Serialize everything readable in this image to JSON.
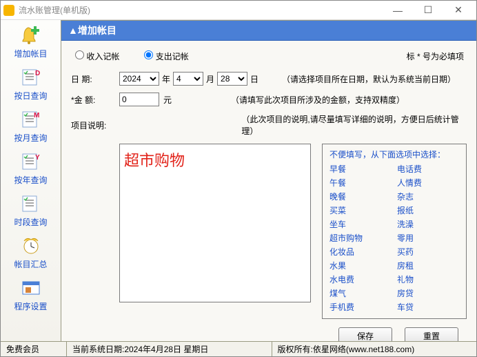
{
  "window": {
    "title": "流水账管理(单机版)"
  },
  "sidebar": {
    "items": [
      {
        "label": "增加帐目"
      },
      {
        "label": "按日查询"
      },
      {
        "label": "按月查询"
      },
      {
        "label": "按年查询"
      },
      {
        "label": "时段查询"
      },
      {
        "label": "帐目汇总"
      },
      {
        "label": "程序设置"
      }
    ]
  },
  "section": {
    "title": "▲增加帐目"
  },
  "radios": {
    "income": "收入记帐",
    "expense": "支出记帐"
  },
  "marker_note": "标 * 号为必填项",
  "date": {
    "label": "日    期:",
    "year": "2024",
    "year_unit": "年",
    "month": "4",
    "month_unit": "月",
    "day": "28",
    "day_unit": "日",
    "hint": "（请选择项目所在日期，默认为系统当前日期）"
  },
  "amount": {
    "label": "*金    额:",
    "value": "0",
    "unit": "元",
    "hint": "（请填写此次项目所涉及的金额，支持双精度）"
  },
  "desc": {
    "label": "项目说明:",
    "value": "超市购物",
    "hint": "（此次项目的说明,请尽量填写详细的说明，方便日后统计管理）"
  },
  "shortcuts": {
    "title": "不便填写，从下面选项中选择：",
    "items": [
      "早餐",
      "电话费",
      "午餐",
      "人情费",
      "晚餐",
      "杂志",
      "买菜",
      "报纸",
      "坐车",
      "洗澡",
      "超市购物",
      "零用",
      "化妆品",
      "买药",
      "水果",
      "房租",
      "水电费",
      "礼物",
      "煤气",
      "房贷",
      "手机费",
      "车贷"
    ]
  },
  "buttons": {
    "save": "保存",
    "reset": "重置"
  },
  "status": {
    "member": "免费会员",
    "date": "当前系统日期:2024年4月28日 星期日",
    "copyright": "版权所有:依星网络(www.net188.com)"
  }
}
